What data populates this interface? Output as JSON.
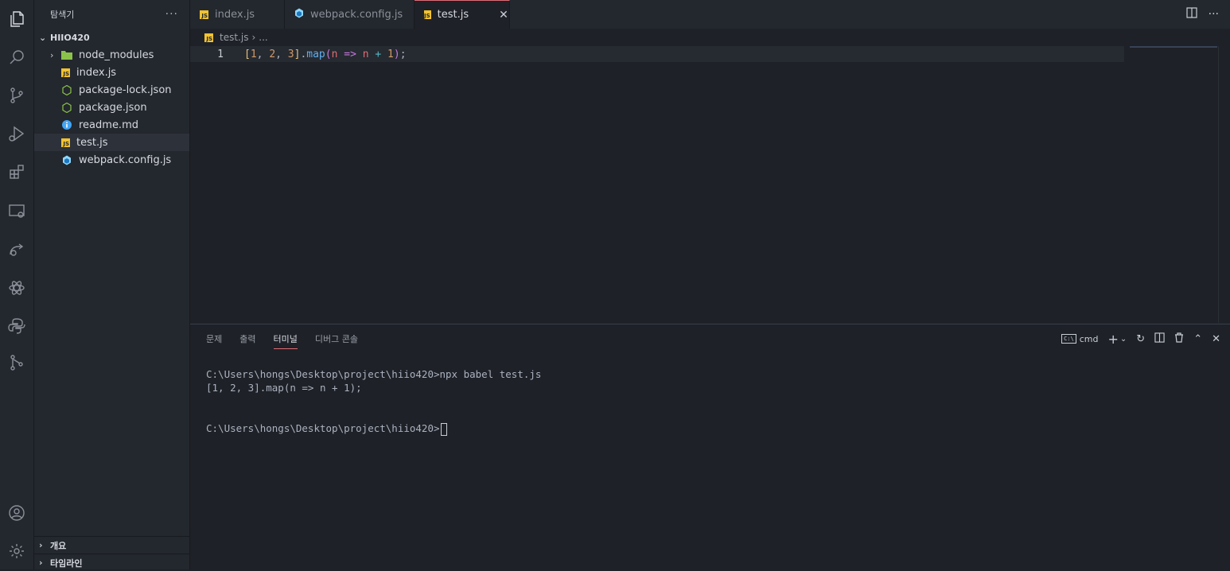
{
  "sidebar": {
    "title": "탐색기",
    "more": "···",
    "project": "HIIO420",
    "items": [
      {
        "label": "node_modules",
        "type": "folder"
      },
      {
        "label": "index.js",
        "type": "js"
      },
      {
        "label": "package-lock.json",
        "type": "json"
      },
      {
        "label": "package.json",
        "type": "json"
      },
      {
        "label": "readme.md",
        "type": "info"
      },
      {
        "label": "test.js",
        "type": "js",
        "selected": true
      },
      {
        "label": "webpack.config.js",
        "type": "webpack"
      }
    ],
    "outline": "개요",
    "timeline": "타임라인"
  },
  "tabs": [
    {
      "label": "index.js",
      "icon": "js-icon"
    },
    {
      "label": "webpack.config.js",
      "icon": "webpack-icon"
    },
    {
      "label": "test.js",
      "icon": "js-icon",
      "active": true
    }
  ],
  "js_badge": "JS",
  "tab_close": "✕",
  "breadcrumb": {
    "file": "test.js",
    "sep": "›",
    "rest": "..."
  },
  "editor": {
    "line_number": "1",
    "tokens": {
      "b1": "[",
      "n1": "1",
      "c1": ", ",
      "n2": "2",
      "c2": ", ",
      "n3": "3",
      "b2": "]",
      "dot": ".",
      "fn": "map",
      "p1": "(",
      "v1": "n",
      "arrow": " => ",
      "v2": "n",
      "plus": " + ",
      "n4": "1",
      "p2": ")",
      "semi": ";"
    }
  },
  "panel": {
    "tabs": [
      "문제",
      "출력",
      "터미널",
      "디버그 콘솔"
    ],
    "active_tab": "터미널",
    "shell_badge": "C:\\",
    "shell": "cmd",
    "terminal_lines": [
      "C:\\Users\\hongs\\Desktop\\project\\hiio420>npx babel test.js",
      "[1, 2, 3].map(n => n + 1);",
      "",
      "",
      "C:\\Users\\hongs\\Desktop\\project\\hiio420>"
    ]
  },
  "colors": {
    "accent": "#e06c75",
    "background": "#1e2127",
    "sidebar": "#23272e"
  }
}
